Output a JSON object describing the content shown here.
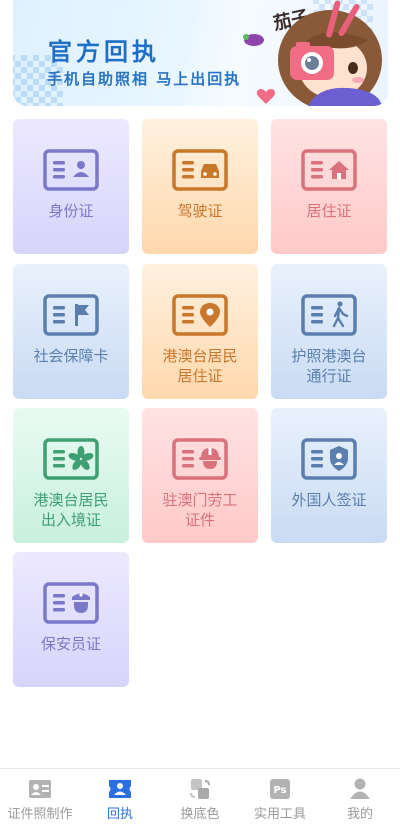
{
  "banner": {
    "title": "官方回执",
    "subtitle": "手机自助照相 马上出回执",
    "tag": "茄子",
    "colors": {
      "title": "#1f6fc6",
      "bg": "#e3f2ff"
    }
  },
  "cards": [
    {
      "label": "身份证",
      "icon": "id-card-person-icon",
      "color": "#7b78c9"
    },
    {
      "label": "驾驶证",
      "icon": "id-card-car-icon",
      "color": "#c9772a"
    },
    {
      "label": "居住证",
      "icon": "id-card-house-icon",
      "color": "#d9727a"
    },
    {
      "label": "社会保障卡",
      "icon": "id-card-flag-icon",
      "color": "#5a7fae"
    },
    {
      "label": "港澳台居民居住证",
      "line1": "港澳台居民",
      "line2": "居住证",
      "icon": "id-card-location-icon",
      "color": "#c9772a"
    },
    {
      "label": "护照港澳台通行证",
      "line1": "护照港澳台",
      "line2": "通行证",
      "icon": "id-card-walker-icon",
      "color": "#5a7fae"
    },
    {
      "label": "港澳台居民出入境证",
      "line1": "港澳台居民",
      "line2": "出入境证",
      "icon": "id-card-bauhinia-icon",
      "color": "#3e9f73"
    },
    {
      "label": "驻澳门劳工证件",
      "line1": "驻澳门劳工",
      "line2": "证件",
      "icon": "id-card-helmet-icon",
      "color": "#d9727a"
    },
    {
      "label": "外国人签证",
      "icon": "id-card-shield-icon",
      "color": "#5a7fae"
    },
    {
      "label": "保安员证",
      "icon": "id-card-police-icon",
      "color": "#7b78c9"
    }
  ],
  "tabbar": {
    "items": [
      {
        "label": "证件照制作",
        "icon": "id-photo-icon",
        "active": false
      },
      {
        "label": "回执",
        "icon": "receipt-icon",
        "active": true
      },
      {
        "label": "换底色",
        "icon": "swap-background-icon",
        "active": false
      },
      {
        "label": "实用工具",
        "icon": "ps-tool-icon",
        "active": false
      },
      {
        "label": "我的",
        "icon": "person-icon",
        "active": false
      }
    ],
    "colors": {
      "active": "#2b6fe0",
      "inactive": "#9a9a9a"
    }
  }
}
